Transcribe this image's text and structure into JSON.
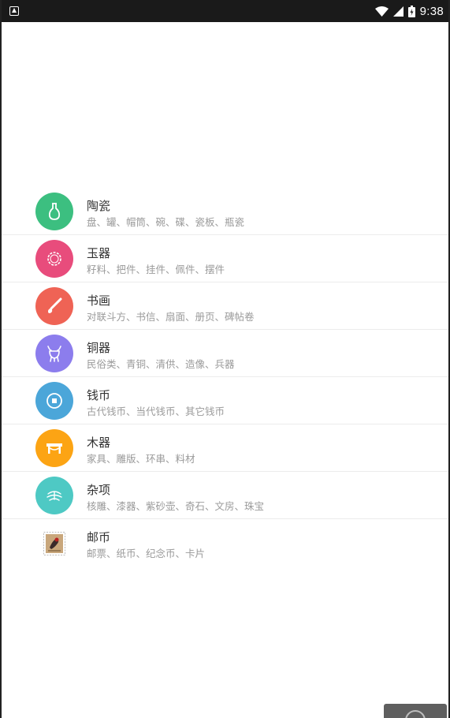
{
  "status_bar": {
    "time": "9:38",
    "icons": [
      "app-notification-icon",
      "wifi-icon",
      "cell-signal-icon",
      "battery-icon"
    ]
  },
  "colors": {
    "ceramics": "#3cbf80",
    "jade": "#e84c7c",
    "painting": "#ef6355",
    "bronze": "#8c7ded",
    "coins": "#4ba6d9",
    "wood": "#fca414",
    "misc": "#4ec9c4"
  },
  "categories": [
    {
      "title": "陶瓷",
      "subtitle": "盘、罐、帽筒、碗、碟、瓷板、瓶瓷",
      "icon": "vase-icon"
    },
    {
      "title": "玉器",
      "subtitle": "籽料、把件、挂件、佩件、摆件",
      "icon": "bracelet-icon"
    },
    {
      "title": "书画",
      "subtitle": "对联斗方、书信、扇面、册页、碑帖卷",
      "icon": "brush-icon"
    },
    {
      "title": "铜器",
      "subtitle": "民俗类、青铜、清供、造像、兵器",
      "icon": "bronze-vessel-icon"
    },
    {
      "title": "钱币",
      "subtitle": "古代钱币、当代钱币、其它钱币",
      "icon": "coin-icon"
    },
    {
      "title": "木器",
      "subtitle": "家具、雕版、环串、料材",
      "icon": "furniture-icon"
    },
    {
      "title": "杂项",
      "subtitle": "核雕、漆器、紫砂壶、奇石、文房、珠宝",
      "icon": "misc-icon"
    },
    {
      "title": "邮币",
      "subtitle": "邮票、纸币、纪念币、卡片",
      "icon": "stamp-icon"
    }
  ]
}
